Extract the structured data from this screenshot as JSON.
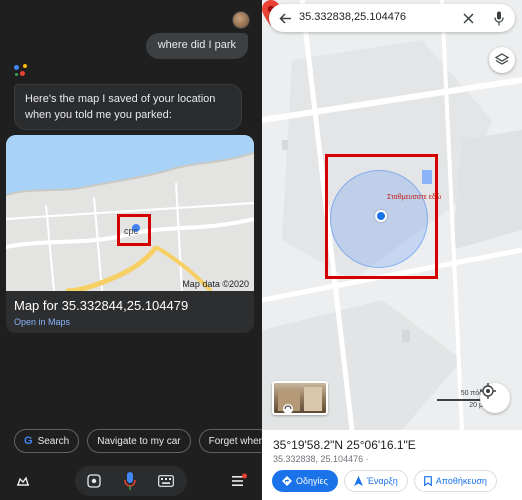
{
  "assistant": {
    "user_query": "where did I park",
    "response_text": "Here's the map I saved of your location when you told me you parked:",
    "map_card": {
      "title": "Map for 35.332844,25.104479",
      "link": "Open in Maps",
      "credit": "Map data ©2020",
      "marker_label": "cpc"
    },
    "chips": [
      "Search",
      "Navigate to my car",
      "Forget where"
    ],
    "bottom_bar_icons": [
      "snapshot-icon",
      "lens-icon",
      "mic-icon",
      "keyboard-icon",
      "updates-icon"
    ]
  },
  "maps": {
    "search_value": "35.332838,25.104476",
    "parked_label": "Σταθμευσατε εδώ",
    "scale": {
      "label_feet": "50 πόδ.",
      "label_meters": "20 μ."
    },
    "place_title": "35°19'58.2\"N 25°06'16.1\"E",
    "place_subtitle": "35.332838, 25.104476 ·",
    "actions": [
      "Οδηγίες",
      "Έναρξη",
      "Αποθήκευση"
    ]
  },
  "colors": {
    "assistant_bg": "#1f1f1f",
    "maps_blue": "#1a73e8",
    "highlight_red": "#d40000",
    "pin_red": "#ea4335"
  }
}
